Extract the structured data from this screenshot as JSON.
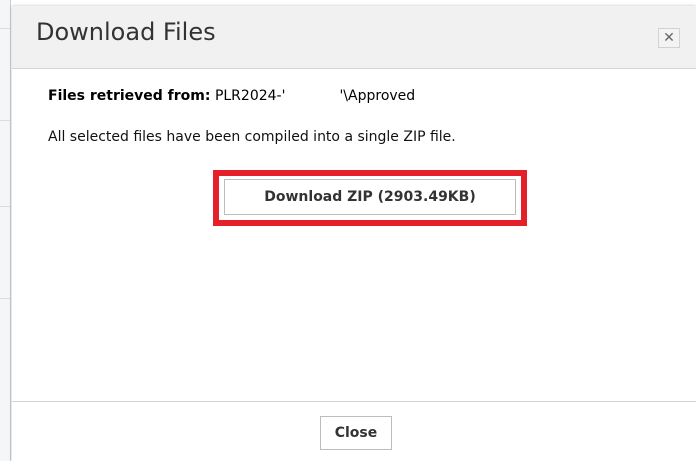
{
  "dialog": {
    "title": "Download Files",
    "close_icon_glyph": "✕",
    "retrieved_label": "Files retrieved from:",
    "retrieved_path_start": "PLR2024-",
    "retrieved_path_mid": "'",
    "retrieved_path_end": "'\\Approved",
    "compiled_message": "All selected files have been compiled into a single ZIP file.",
    "download_button_label": "Download ZIP (2903.49KB)",
    "close_button_label": "Close"
  },
  "colors": {
    "highlight": "#e4202a",
    "titlebar": "#f1f1f1"
  },
  "icons": {
    "close": "close-icon"
  }
}
